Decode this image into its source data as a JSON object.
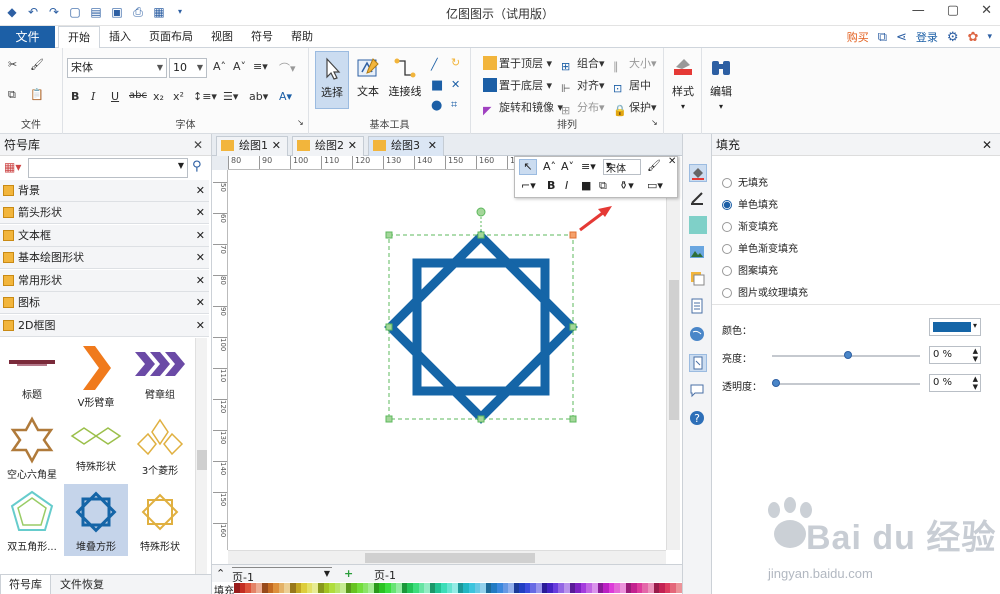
{
  "window": {
    "title": "亿图图示（试用版）"
  },
  "menu": {
    "file": "文件",
    "tabs": [
      "开始",
      "插入",
      "页面布局",
      "视图",
      "符号",
      "帮助"
    ],
    "buy": "购买",
    "login": "登录"
  },
  "ribbon": {
    "groups": {
      "file": "文件",
      "font": "字体",
      "basic_tools": "基本工具",
      "arrange": "排列"
    },
    "font": {
      "family": "宋体",
      "size": "10"
    },
    "tools": {
      "select": "选择",
      "text": "文本",
      "connector": "连接线"
    },
    "arrange": {
      "bring_front": "置于顶层",
      "send_back": "置于底层",
      "rotate": "旋转和镜像",
      "group": "组合",
      "align": "对齐",
      "distribute": "分布",
      "size": "大小",
      "center": "居中",
      "protect": "保护"
    },
    "style": "样式",
    "edit": "编辑"
  },
  "library": {
    "title": "符号库",
    "items": [
      "背景",
      "箭头形状",
      "文本框",
      "基本绘图形状",
      "常用形状",
      "图标",
      "2D框图"
    ],
    "shapes": [
      "标题",
      "V形臂章",
      "臂章组",
      "空心六角星",
      "特殊形状",
      "3个菱形",
      "双五角形...",
      "堆叠方形",
      "特殊形状"
    ],
    "bottom_tabs": [
      "符号库",
      "文件恢复"
    ]
  },
  "documents": {
    "tabs": [
      "绘图1",
      "绘图2",
      "绘图3"
    ],
    "ruler_h": [
      "80",
      "90",
      "100",
      "110",
      "120",
      "130",
      "140",
      "150",
      "160",
      "170"
    ],
    "ruler_v": [
      "50",
      "60",
      "70",
      "80",
      "90",
      "100",
      "110",
      "120",
      "130",
      "140",
      "150",
      "160"
    ]
  },
  "minitoolbar": {
    "font": "宋体"
  },
  "pagebar": {
    "page": "页-1",
    "page_tab": "页-1"
  },
  "colorbar": {
    "label": "填充"
  },
  "fill": {
    "title": "填充",
    "options": [
      "无填充",
      "单色填充",
      "渐变填充",
      "单色渐变填充",
      "图案填充",
      "图片或纹理填充"
    ],
    "selected": 1,
    "color_label": "颜色：",
    "color_value": "#1565a7",
    "brightness_label": "亮度：",
    "brightness_value": "0 %",
    "brightness_level": 0.5,
    "transparency_label": "透明度：",
    "transparency_value": "0 %",
    "transparency_level": 0.0
  },
  "watermark": {
    "brand": "Bai du 经验",
    "url": "jingyan.baidu.com"
  },
  "colors": {
    "accent": "#1c5fa6",
    "shape": "#1565a7",
    "selection": "#5cb85c",
    "arrow": "#e53935"
  }
}
